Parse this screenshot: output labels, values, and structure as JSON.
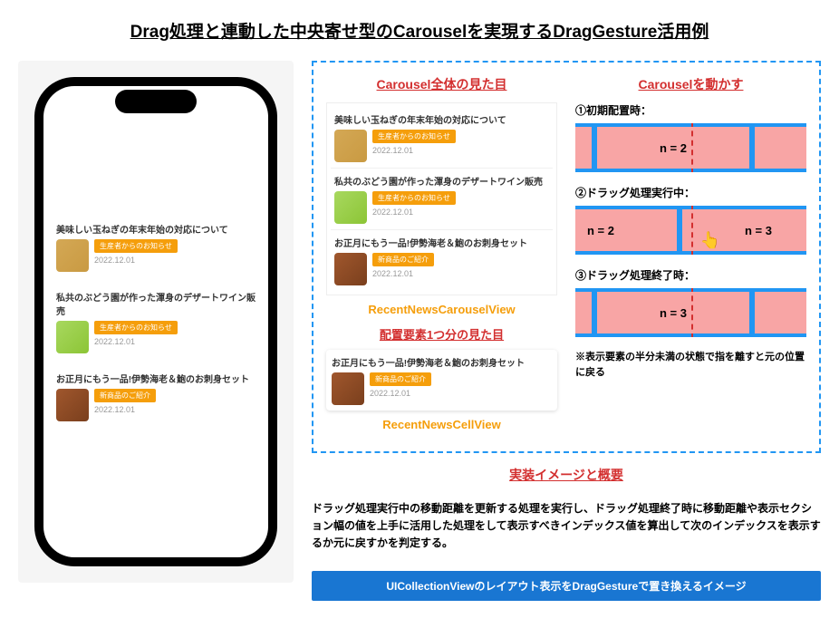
{
  "title": "Drag処理と連動した中央寄せ型のCarouselを実現するDragGesture活用例",
  "phone_items": [
    {
      "title": "美味しい玉ねぎの年末年始の対応について",
      "badge": "生産者からのお知らせ",
      "date": "2022.12.01"
    },
    {
      "title": "私共のぶどう園が作った渾身のデザートワイン販売",
      "badge": "生産者からのお知らせ",
      "date": "2022.12.01"
    },
    {
      "title": "お正月にもう一品!伊勢海老＆鮑のお刺身セット",
      "badge": "新商品のご紹介",
      "date": "2022.12.01"
    }
  ],
  "carousel_section_title": "Carousel全体の見た目",
  "carousel_caption": "RecentNewsCarouselView",
  "single_section_title": "配置要素1つ分の見た目",
  "single_caption": "RecentNewsCellView",
  "move_section_title": "Carouselを動かす",
  "steps": {
    "s1": "①初期配置時：",
    "s2": "②ドラッグ処理実行中：",
    "s3": "③ドラッグ処理終了時："
  },
  "slides": {
    "n2": "n = 2",
    "n3": "n = 3"
  },
  "note": "※表示要素の半分未満の状態で指を離すと元の位置に戻る",
  "impl_title": "実装イメージと概要",
  "impl_desc": "ドラッグ処理実行中の移動距離を更新する処理を実行し、ドラッグ処理終了時に移動距離や表示セクション幅の値を上手に活用した処理をして表示すべきインデックス値を算出して次のインデックスを表示するか元に戻すかを判定する。",
  "summary_bar": "UICollectionViewのレイアウト表示をDragGestureで置き換えるイメージ"
}
